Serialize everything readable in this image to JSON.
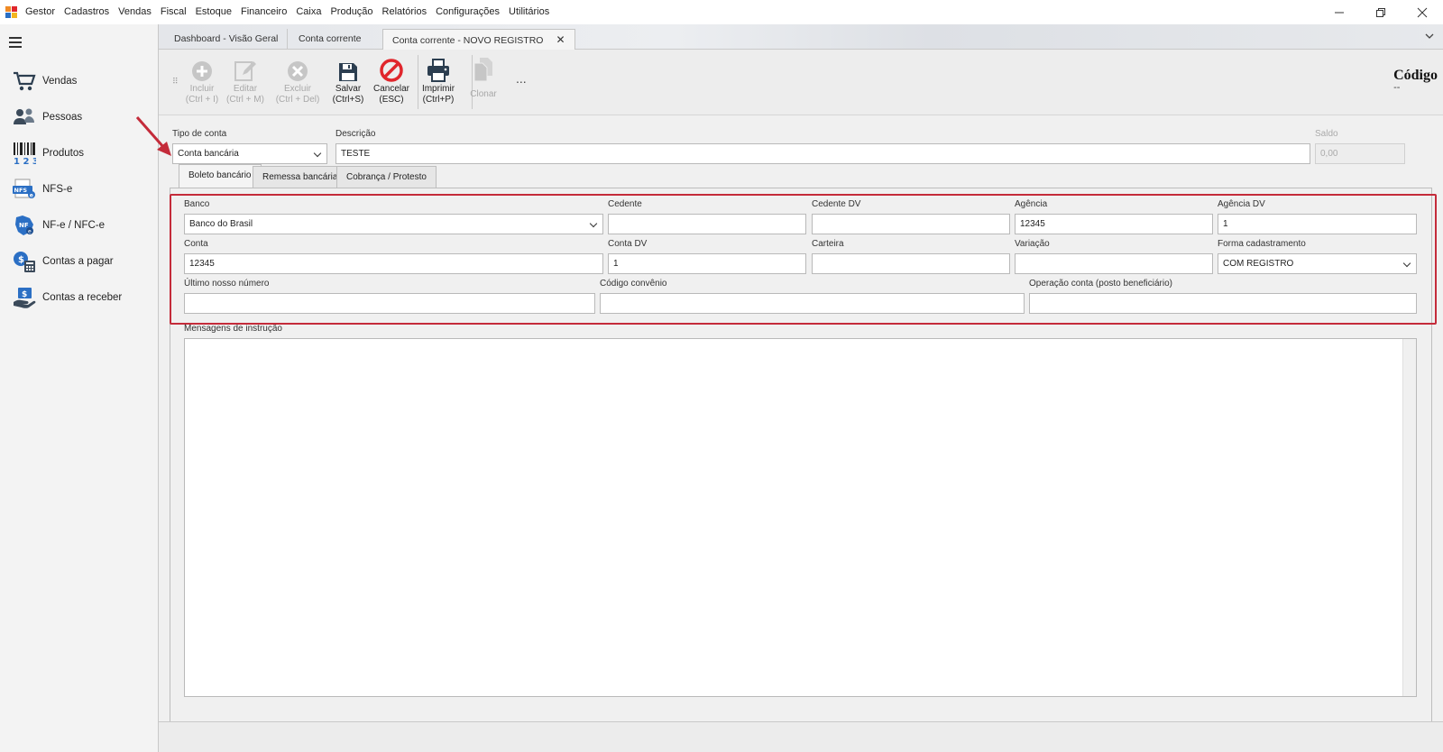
{
  "menubar": {
    "items": [
      "Gestor",
      "Cadastros",
      "Vendas",
      "Fiscal",
      "Estoque",
      "Financeiro",
      "Caixa",
      "Produção",
      "Relatórios",
      "Configurações",
      "Utilitários"
    ],
    "window_controls": [
      "minimize-icon",
      "restore-icon",
      "close-icon"
    ]
  },
  "sidebar": {
    "items": [
      {
        "label": "Vendas",
        "icon": "shopping-cart-icon"
      },
      {
        "label": "Pessoas",
        "icon": "people-icon"
      },
      {
        "label": "Produtos",
        "icon": "barcode-icon"
      },
      {
        "label": "NFS-e",
        "icon": "nfse-icon"
      },
      {
        "label": "NF-e / NFC-e",
        "icon": "nfe-icon"
      },
      {
        "label": "Contas a pagar",
        "icon": "bills-payable-icon"
      },
      {
        "label": "Contas a receber",
        "icon": "bills-receivable-icon"
      }
    ]
  },
  "doc_tabs": {
    "items": [
      "Dashboard - Visão Geral",
      "Conta corrente",
      "Conta corrente - NOVO REGISTRO"
    ],
    "active": 2
  },
  "toolbar": {
    "buttons": [
      {
        "label": "Incluir\n(Ctrl + I)",
        "enabled": false
      },
      {
        "label": "Editar\n(Ctrl + M)",
        "enabled": false
      },
      {
        "label": "Excluir\n(Ctrl + Del)",
        "enabled": false
      },
      {
        "label": "Salvar\n(Ctrl+S)",
        "enabled": true
      },
      {
        "label": "Cancelar\n(ESC)",
        "enabled": true
      },
      {
        "label": "Imprimir\n(Ctrl+P)",
        "enabled": true
      },
      {
        "label": "Clonar",
        "enabled": false
      }
    ],
    "more": "...",
    "code_title": "Código",
    "code_value": "--"
  },
  "form": {
    "tipo_conta": {
      "label": "Tipo de conta",
      "value": "Conta bancária"
    },
    "descricao": {
      "label": "Descrição",
      "value": "TESTE"
    },
    "saldo": {
      "label": "Saldo",
      "value": "0,00"
    },
    "inner_tabs": [
      "Boleto bancário",
      "Remessa bancária",
      "Cobrança / Protesto"
    ],
    "banco": {
      "label": "Banco",
      "value": "Banco do Brasil"
    },
    "cedente": {
      "label": "Cedente",
      "value": ""
    },
    "cedente_dv": {
      "label": "Cedente DV",
      "value": ""
    },
    "agencia": {
      "label": "Agência",
      "value": "12345"
    },
    "agencia_dv": {
      "label": "Agência DV",
      "value": "1"
    },
    "conta": {
      "label": "Conta",
      "value": "12345"
    },
    "conta_dv": {
      "label": "Conta DV",
      "value": "1"
    },
    "carteira": {
      "label": "Carteira",
      "value": ""
    },
    "variacao": {
      "label": "Variação",
      "value": ""
    },
    "forma_cadastramento": {
      "label": "Forma cadastramento",
      "value": "COM REGISTRO"
    },
    "ultimo_nosso_numero": {
      "label": "Último nosso número",
      "value": ""
    },
    "codigo_convenio": {
      "label": "Código convênio",
      "value": ""
    },
    "operacao_conta": {
      "label": "Operação conta (posto beneficiário)",
      "value": ""
    },
    "mensagens": {
      "label": "Mensagens de instrução",
      "value": ""
    }
  },
  "colors": {
    "highlight": "#c42b3a",
    "cancel": "#e0262c",
    "arrow": "#c42b3a"
  }
}
